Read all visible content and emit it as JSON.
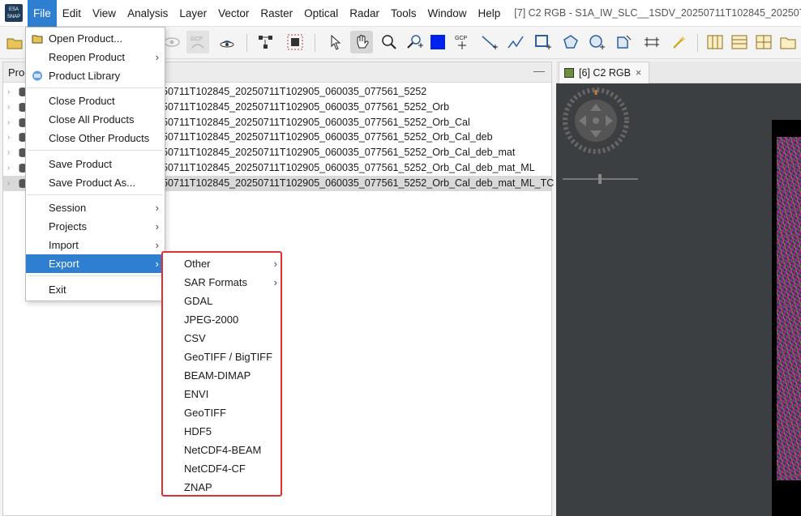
{
  "menubar": {
    "logo_text": "ESA SNAP",
    "items": [
      "File",
      "Edit",
      "View",
      "Analysis",
      "Layer",
      "Vector",
      "Raster",
      "Optical",
      "Radar",
      "Tools",
      "Window",
      "Help"
    ],
    "window_title": "[7] C2 RGB - S1A_IW_SLC__1SDV_20250711T102845_20250711"
  },
  "toolbar": {
    "gcp_label": "GCP",
    "icons": [
      "open-product-icon",
      "eye-icon",
      "gcp-icon",
      "visibility-eye-icon",
      "graph-builder-icon",
      "batch-processing-icon",
      "select-arrow-icon",
      "pan-hand-icon",
      "zoom-icon",
      "zoom-tool-icon",
      "rectangle-drawing-icon",
      "gcp-tool-icon",
      "line-drawing-icon",
      "polyline-drawing-icon",
      "rectangle-add-icon",
      "polygon-drawing-icon",
      "ellipse-drawing-icon",
      "shape-tool-icon",
      "range-finder-icon",
      "magic-wand-icon",
      "tile-vertical-icon",
      "tile-horizontal-icon",
      "tile-grid-icon",
      "folder-icon"
    ]
  },
  "left_panel": {
    "title": "Proc",
    "rows": [
      "50711T102845_20250711T102905_060035_077561_5252",
      "50711T102845_20250711T102905_060035_077561_5252_Orb",
      "50711T102845_20250711T102905_060035_077561_5252_Orb_Cal",
      "50711T102845_20250711T102905_060035_077561_5252_Orb_Cal_deb",
      "50711T102845_20250711T102905_060035_077561_5252_Orb_Cal_deb_mat",
      "50711T102845_20250711T102905_060035_077561_5252_Orb_Cal_deb_mat_ML",
      "50711T102845_20250711T102905_060035_077561_5252_Orb_Cal_deb_mat_ML_TC"
    ],
    "selected_row": 6,
    "minimize_symbol": "—"
  },
  "right_panel": {
    "tab_label": "[6] C2 RGB",
    "tab_close": "×"
  },
  "file_menu": {
    "items": [
      {
        "label": "Open Product...",
        "icon": "open-folder-icon",
        "submenu": false
      },
      {
        "label": "Reopen Product",
        "submenu": true
      },
      {
        "label": "Product Library",
        "icon": "product-library-icon",
        "submenu": false
      },
      {
        "label": "Close Product",
        "submenu": false
      },
      {
        "label": "Close All Products",
        "submenu": false
      },
      {
        "label": "Close Other Products",
        "submenu": false
      },
      {
        "label": "Save Product",
        "submenu": false
      },
      {
        "label": "Save Product As...",
        "submenu": false
      },
      {
        "label": "Session",
        "submenu": true
      },
      {
        "label": "Projects",
        "submenu": true
      },
      {
        "label": "Import",
        "submenu": true
      },
      {
        "label": "Export",
        "submenu": true,
        "active": true
      },
      {
        "label": "Exit",
        "submenu": false
      }
    ]
  },
  "export_menu": {
    "items": [
      {
        "label": "Other",
        "submenu": true
      },
      {
        "label": "SAR Formats",
        "submenu": true
      },
      {
        "label": "GDAL",
        "submenu": false
      },
      {
        "label": "JPEG-2000",
        "submenu": false
      },
      {
        "label": "CSV",
        "submenu": false
      },
      {
        "label": "GeoTIFF / BigTIFF",
        "submenu": false
      },
      {
        "label": "BEAM-DIMAP",
        "submenu": false
      },
      {
        "label": "ENVI",
        "submenu": false
      },
      {
        "label": "GeoTIFF",
        "submenu": false
      },
      {
        "label": "HDF5",
        "submenu": false
      },
      {
        "label": "NetCDF4-BEAM",
        "submenu": false
      },
      {
        "label": "NetCDF4-CF",
        "submenu": false
      },
      {
        "label": "ZNAP",
        "submenu": false
      }
    ],
    "highlight_color": "#e03131"
  },
  "colors": {
    "menu_highlight": "#2e7fd1",
    "image_background": "#3c3f41"
  }
}
